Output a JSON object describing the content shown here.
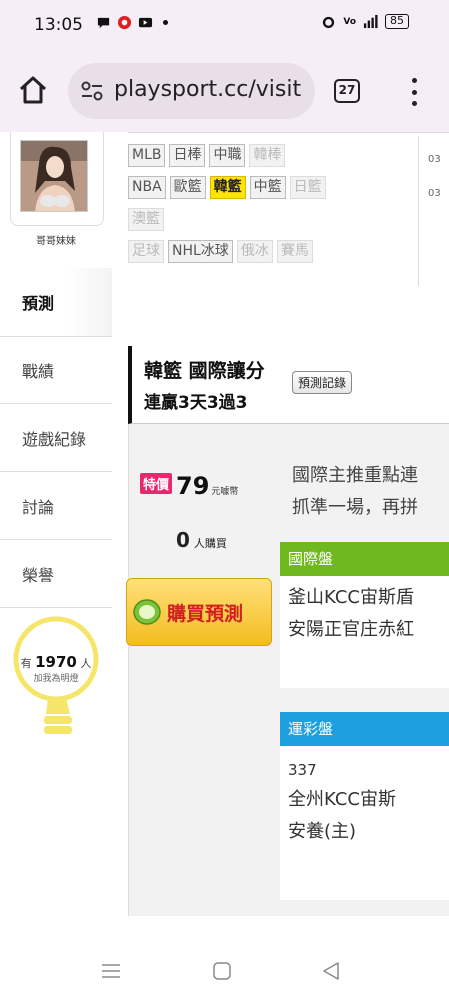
{
  "status": {
    "time": "13:05",
    "battery": "85"
  },
  "browser": {
    "url": "playsport.cc/visit",
    "tab_count": "27"
  },
  "profile": {
    "name": "哥哥妹妹"
  },
  "sidebar": {
    "items": [
      {
        "label": "預測"
      },
      {
        "label": "戰績"
      },
      {
        "label": "遊戲紀錄"
      },
      {
        "label": "討論"
      },
      {
        "label": "榮譽"
      }
    ],
    "bulb_prefix": "有",
    "bulb_count": "1970",
    "bulb_suffix": "人",
    "bulb_caption": "加我為明燈"
  },
  "tags": {
    "row1": [
      "MLB",
      "日棒",
      "中職",
      "韓棒"
    ],
    "row2": [
      "NBA",
      "歐籃",
      "韓籃",
      "中籃",
      "日籃"
    ],
    "row3": [
      "澳籃"
    ],
    "row4": [
      "足球",
      "NHL冰球",
      "俄冰",
      "賽馬"
    ]
  },
  "dates": [
    "03",
    "03"
  ],
  "panel": {
    "title": "韓籃 國際讓分",
    "subtitle": "連贏3天3過3",
    "record_button": "預測記錄",
    "special_badge": "特價",
    "price": "79",
    "price_unit": "元噱幣",
    "buyers_count": "0",
    "buyers_label": "人購買",
    "buy_button": "購買預測",
    "description": [
      "國際主推重點連",
      "抓準一場，再拼"
    ],
    "card1": {
      "header": "國際盤",
      "lines": [
        "釜山KCC宙斯盾",
        "安陽正官庄赤紅"
      ]
    },
    "card2": {
      "header": "運彩盤",
      "number": "337",
      "lines": [
        "全州KCC宙斯",
        "安養(主)"
      ]
    }
  },
  "colors": {
    "accent_yellow": "#ffe400",
    "special_pink": "#e6286e",
    "intl_green": "#6fb81d",
    "lottery_blue": "#1ea0e0",
    "buy_red": "#d02020"
  }
}
